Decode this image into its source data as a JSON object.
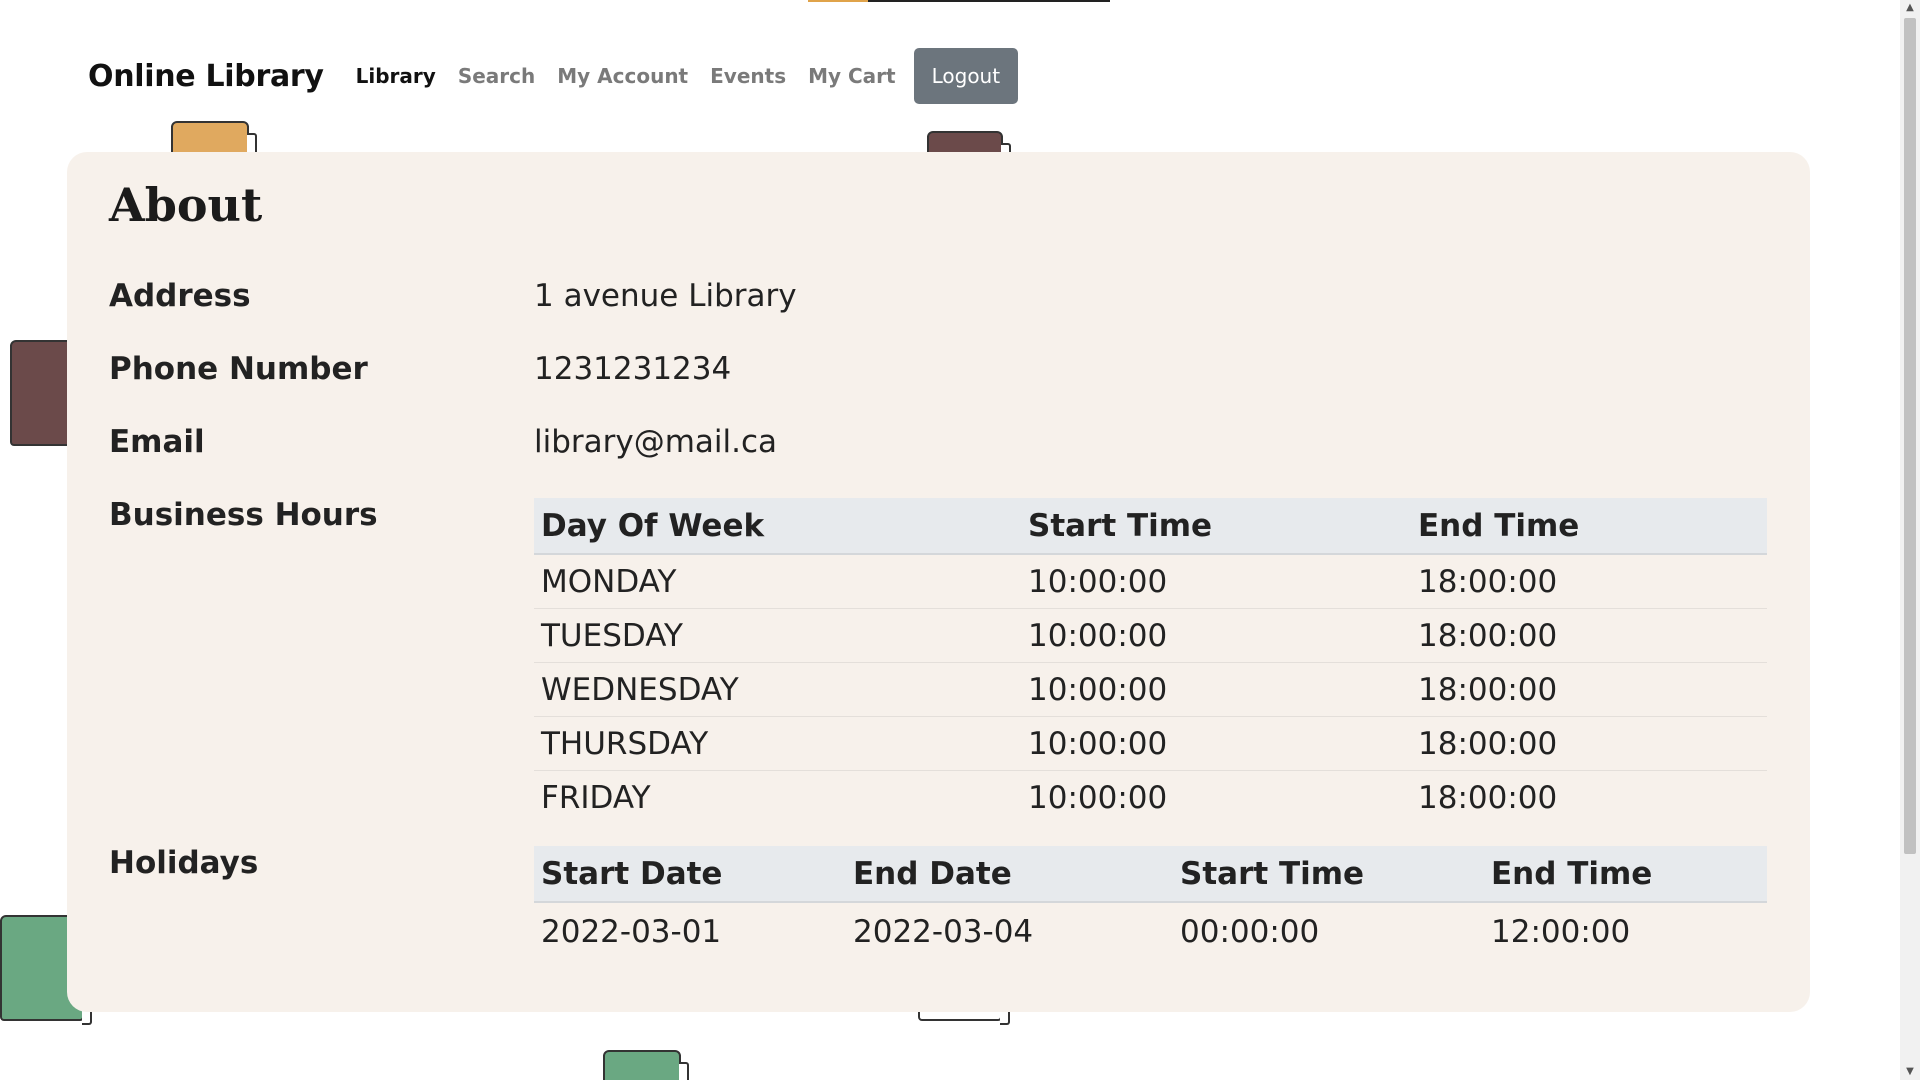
{
  "nav": {
    "brand": "Online Library",
    "links": [
      "Library",
      "Search",
      "My Account",
      "Events",
      "My Cart"
    ],
    "logout": "Logout"
  },
  "about": {
    "title": "About",
    "address_label": "Address",
    "address": "1 avenue Library",
    "phone_label": "Phone Number",
    "phone": "1231231234",
    "email_label": "Email",
    "email": "library@mail.ca",
    "hours_label": "Business Hours",
    "holidays_label": "Holidays"
  },
  "hours": {
    "headers": [
      "Day Of Week",
      "Start Time",
      "End Time"
    ],
    "rows": [
      [
        "MONDAY",
        "10:00:00",
        "18:00:00"
      ],
      [
        "TUESDAY",
        "10:00:00",
        "18:00:00"
      ],
      [
        "WEDNESDAY",
        "10:00:00",
        "18:00:00"
      ],
      [
        "THURSDAY",
        "10:00:00",
        "18:00:00"
      ],
      [
        "FRIDAY",
        "10:00:00",
        "18:00:00"
      ]
    ]
  },
  "holidays": {
    "headers": [
      "Start Date",
      "End Date",
      "Start Time",
      "End Time"
    ],
    "rows": [
      [
        "2022-03-01",
        "2022-03-04",
        "00:00:00",
        "12:00:00"
      ]
    ]
  },
  "colors": {
    "card_bg": "#f7f1eb",
    "logout_bg": "#6c757d",
    "book_orange": "#e0a95f",
    "book_brown": "#6b4a4a",
    "book_green": "#6aa882"
  }
}
